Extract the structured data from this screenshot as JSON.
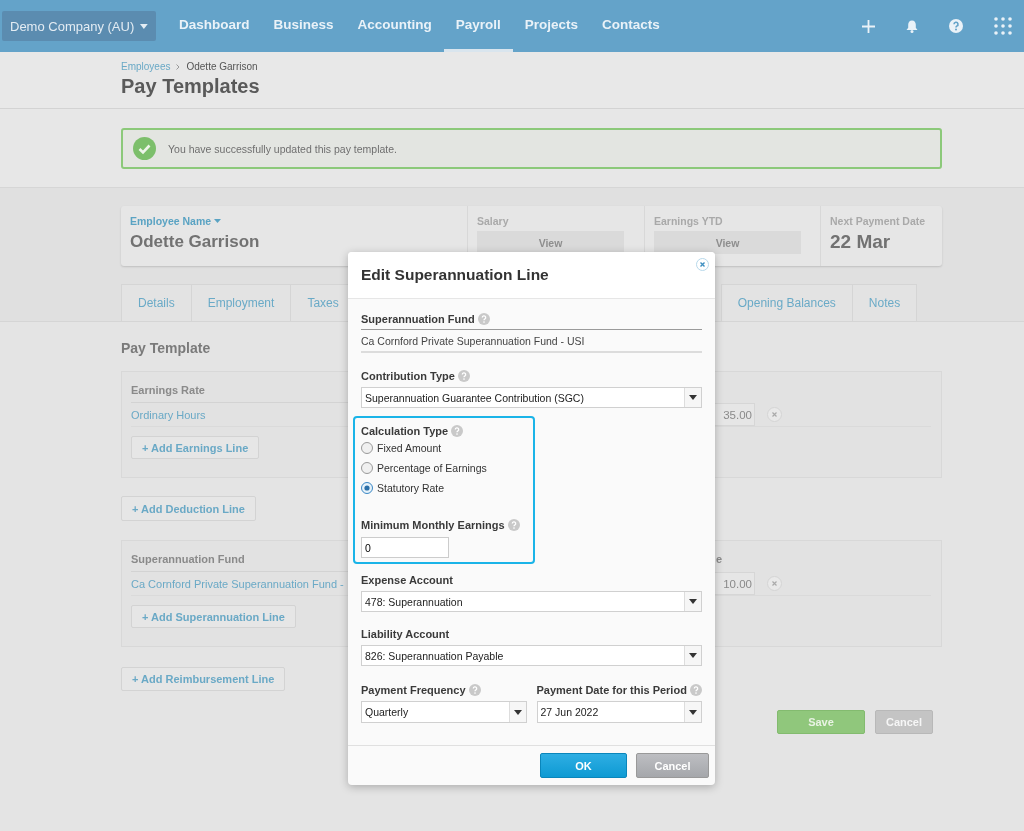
{
  "nav": {
    "company": "Demo Company (AU)",
    "items": [
      {
        "label": "Dashboard",
        "selected": false
      },
      {
        "label": "Business",
        "selected": false
      },
      {
        "label": "Accounting",
        "selected": false
      },
      {
        "label": "Payroll",
        "selected": true
      },
      {
        "label": "Projects",
        "selected": false
      },
      {
        "label": "Contacts",
        "selected": false
      }
    ]
  },
  "breadcrumb": [
    {
      "label": "Employees",
      "kind": "link"
    },
    {
      "label": "Odette Garrison",
      "kind": "current"
    }
  ],
  "page_title": "Pay Templates",
  "alert": {
    "message": "You have successfully updated this pay template."
  },
  "employee_card": {
    "name_label": "Employee Name",
    "name": "Odette Garrison",
    "salary_label": "Salary",
    "salary_button": "View",
    "earnings_label": "Earnings YTD",
    "earnings_button": "View",
    "next_payment_label": "Next Payment Date",
    "next_payment": "22 Mar"
  },
  "tabs": [
    {
      "label": "Details"
    },
    {
      "label": "Employment"
    },
    {
      "label": "Taxes"
    },
    {
      "label": "Opening Balances"
    },
    {
      "label": "Notes"
    }
  ],
  "pay_template": {
    "title": "Pay Template",
    "earnings": {
      "column_1": "Earnings Rate",
      "rows": [
        {
          "name": "Ordinary Hours",
          "amount": "35.00"
        }
      ],
      "add_button": "+ Add Earnings Line"
    },
    "deduction_button": "+ Add Deduction Line",
    "superannuation": {
      "column_1": "Superannuation Fund",
      "column_2": "e",
      "rows": [
        {
          "name": "Ca Cornford Private Superannuation Fund -",
          "amount": "10.00"
        }
      ],
      "add_button": "+ Add Superannuation Line"
    },
    "reimbursement_button": "+ Add Reimbursement Line"
  },
  "actions": {
    "save": "Save",
    "cancel": "Cancel"
  },
  "dialog": {
    "title": "Edit Superannuation Line",
    "fund_label": "Superannuation Fund",
    "fund_value": "Ca Cornford Private Superannuation Fund - USI",
    "contribution_label": "Contribution Type",
    "contribution_value": "Superannuation Guarantee Contribution (SGC)",
    "calculation": {
      "label": "Calculation Type",
      "highlighted": true,
      "options": [
        {
          "label": "Fixed Amount",
          "selected": false
        },
        {
          "label": "Percentage of Earnings",
          "selected": false
        },
        {
          "label": "Statutory Rate",
          "selected": true
        }
      ]
    },
    "min_label": "Minimum Monthly Earnings",
    "min_value": "0",
    "expense_label": "Expense Account",
    "expense_value": "478: Superannuation",
    "liability_label": "Liability Account",
    "liability_value": "826: Superannuation Payable",
    "frequency_label": "Payment Frequency",
    "frequency_value": "Quarterly",
    "date_label": "Payment Date for this Period",
    "date_value": "27 Jun 2022",
    "ok": "OK",
    "cancel": "Cancel"
  }
}
